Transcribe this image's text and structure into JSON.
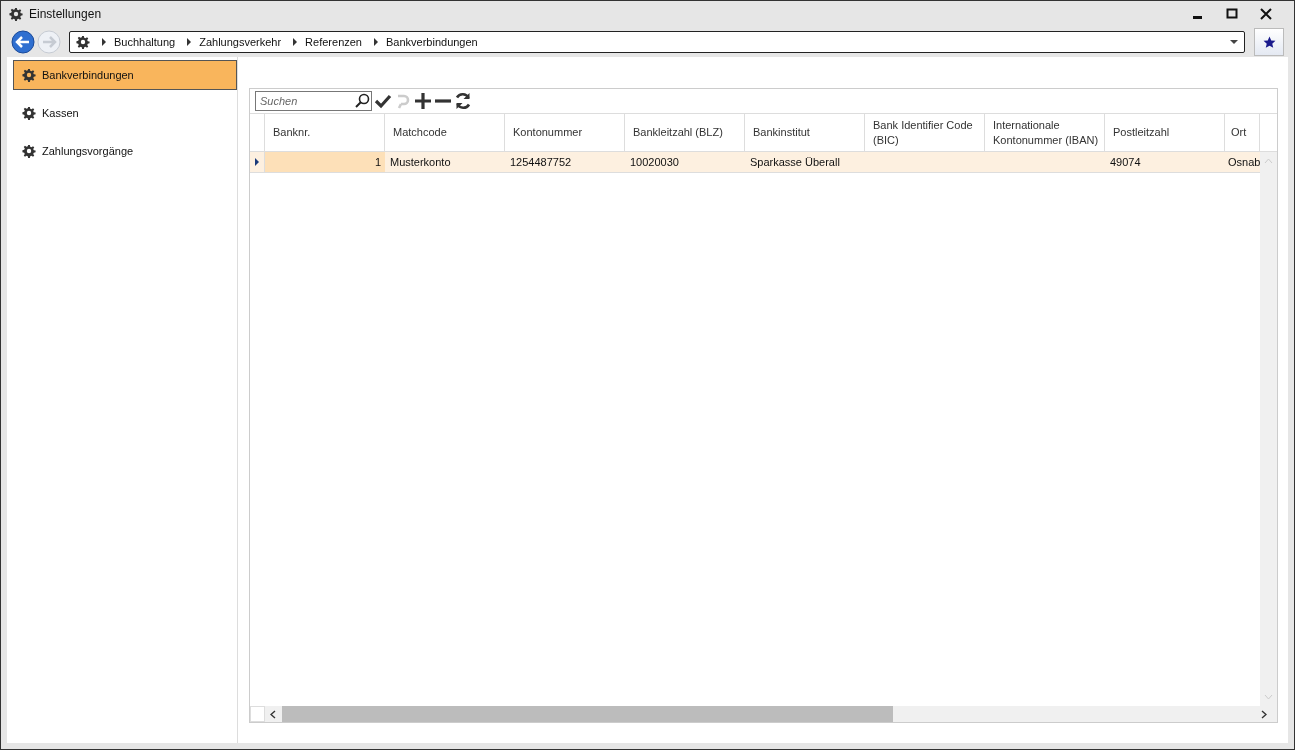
{
  "window": {
    "title": "Einstellungen"
  },
  "breadcrumb": [
    "Buchhaltung",
    "Zahlungsverkehr",
    "Referenzen",
    "Bankverbindungen"
  ],
  "sidebar": {
    "items": [
      {
        "label": "Bankverbindungen",
        "selected": true
      },
      {
        "label": "Kassen",
        "selected": false
      },
      {
        "label": "Zahlungsvorgänge",
        "selected": false
      }
    ]
  },
  "search": {
    "placeholder": "Suchen"
  },
  "toolbar": [
    {
      "kind": "check",
      "disabled": false
    },
    {
      "kind": "undo",
      "disabled": true
    },
    {
      "kind": "add",
      "disabled": false
    },
    {
      "kind": "remove",
      "disabled": false
    },
    {
      "kind": "refresh",
      "disabled": false
    }
  ],
  "table": {
    "columns": [
      "Banknr.",
      "Matchcode",
      "Kontonummer",
      "Bankleitzahl (BLZ)",
      "Bankinstitut",
      "Bank Identifier Code (BIC)",
      "Internationale Kontonummer (IBAN)",
      "Postleitzahl",
      "Ort"
    ],
    "rows": [
      {
        "selected": true,
        "cells": [
          "1",
          "Musterkonto",
          "1254487752",
          "10020030",
          "Sparkasse Überall",
          "",
          "",
          "49074",
          "Osnab"
        ]
      }
    ]
  }
}
